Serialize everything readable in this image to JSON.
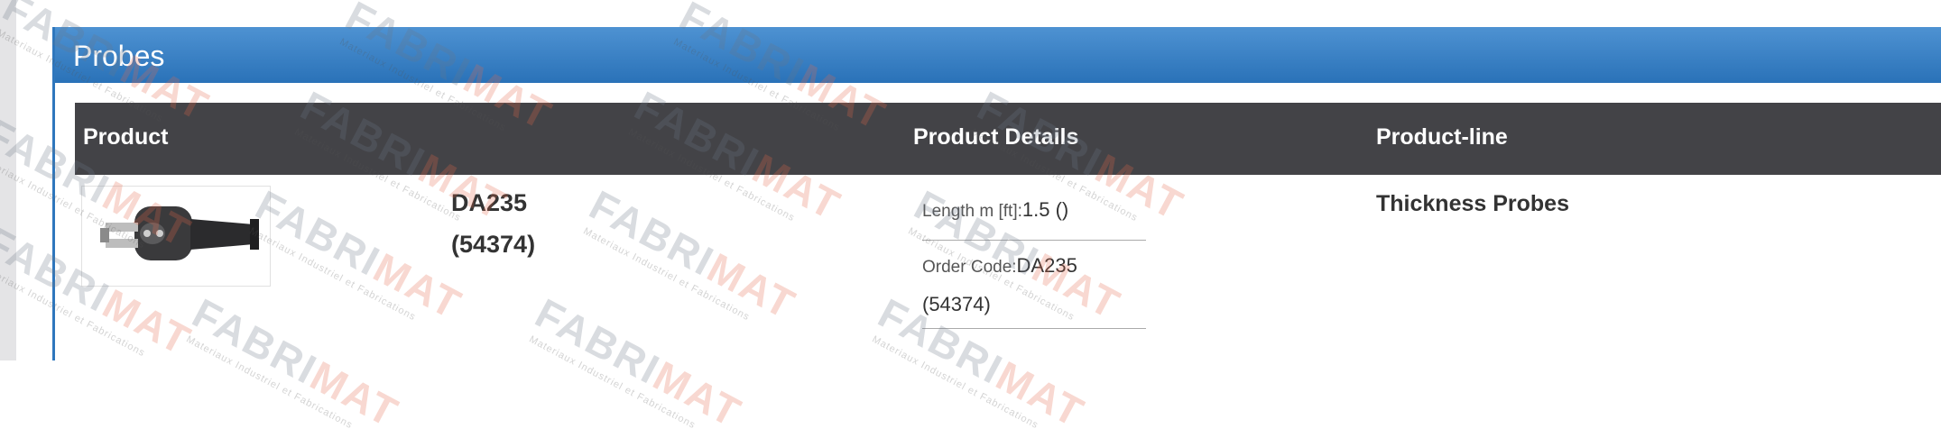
{
  "panel": {
    "title": "Probes"
  },
  "table": {
    "headers": {
      "product": "Product",
      "details": "Product Details",
      "line": "Product-line"
    },
    "row": {
      "image_icon": "probe-connector-image",
      "product_name": "DA235",
      "product_code": "(54374)",
      "details": {
        "length_label": "Length m [ft]:",
        "length_value": "1.5 ()",
        "order_label": "Order Code:",
        "order_value": "DA235",
        "order_code_extra": "(54374)"
      },
      "product_line": "Thickness Probes"
    }
  },
  "watermark": {
    "logo_part1": "FABRI",
    "logo_part2": "MAT",
    "subtitle": "Materiaux Industriel et Fabrications"
  },
  "colors": {
    "header_blue": "#2f77bd",
    "table_header": "#434347",
    "watermark_orange": "#e6694a"
  }
}
